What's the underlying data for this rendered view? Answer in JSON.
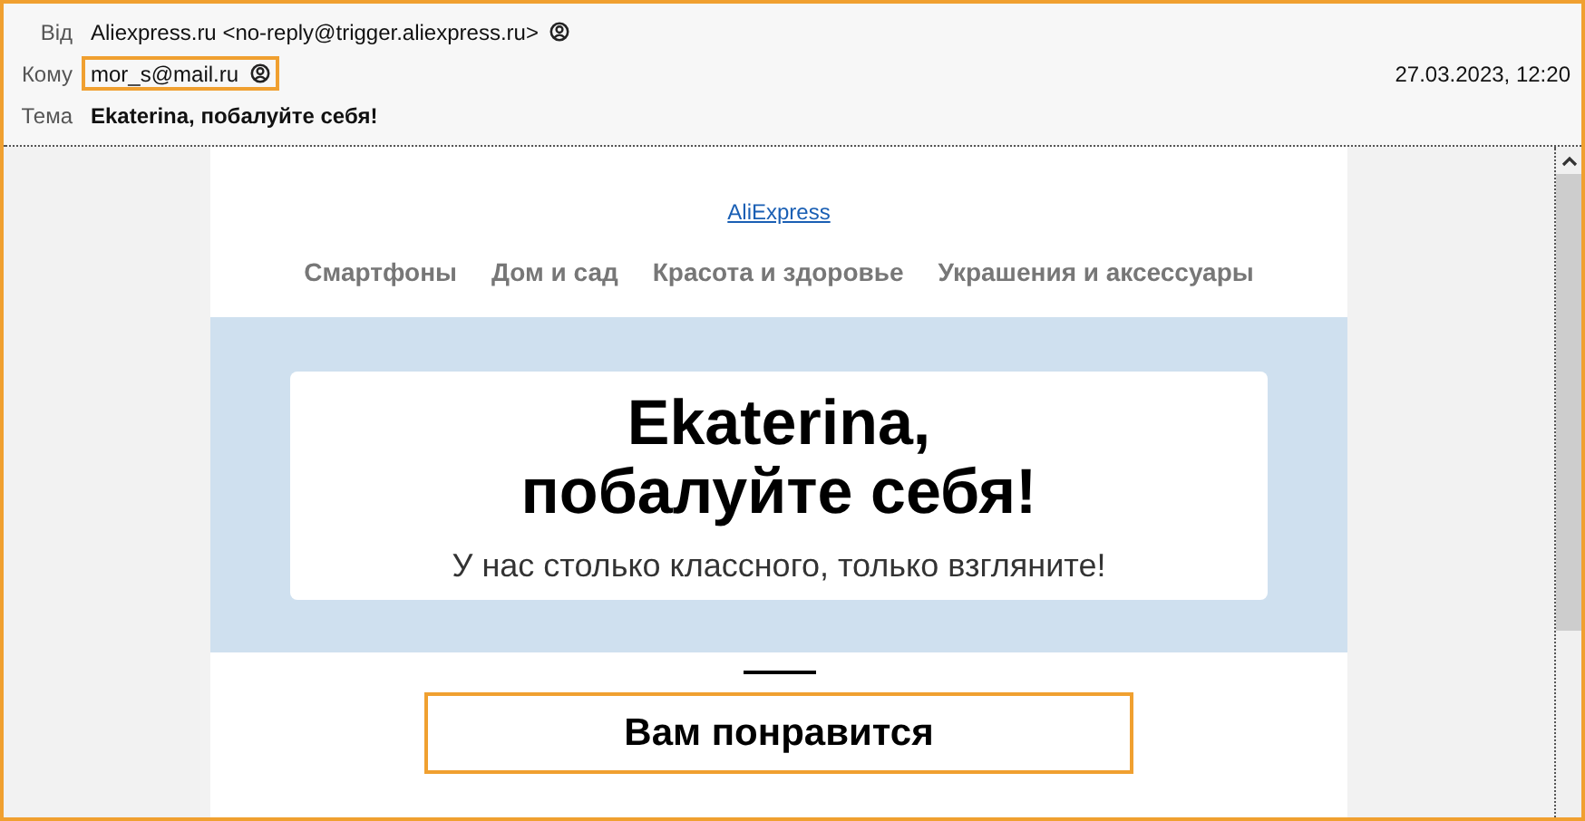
{
  "header": {
    "fields": [
      {
        "label": "Від",
        "value": "Aliexpress.ru <no-reply@trigger.aliexpress.ru>",
        "contact_icon": true,
        "highlighted": false,
        "bold": false
      },
      {
        "label": "Кому",
        "value": "mor_s@mail.ru",
        "contact_icon": true,
        "highlighted": true,
        "bold": false
      },
      {
        "label": "Тема",
        "value": "Ekaterina, побалуйте себя!",
        "contact_icon": false,
        "highlighted": false,
        "bold": true
      }
    ],
    "date": "27.03.2023, 12:20"
  },
  "email": {
    "logo_link": "AliExpress",
    "nav": [
      "Смартфоны",
      "Дом и сад",
      "Красота и здоровье",
      "Украшения и аксессуары"
    ],
    "hero": {
      "title_line_1": "Ekaterina,",
      "title_line_2": "побалуйте себя!",
      "subtitle": "У нас столько классного, только взгляните!"
    },
    "section_title": "Вам понравится",
    "section_highlighted": true
  }
}
